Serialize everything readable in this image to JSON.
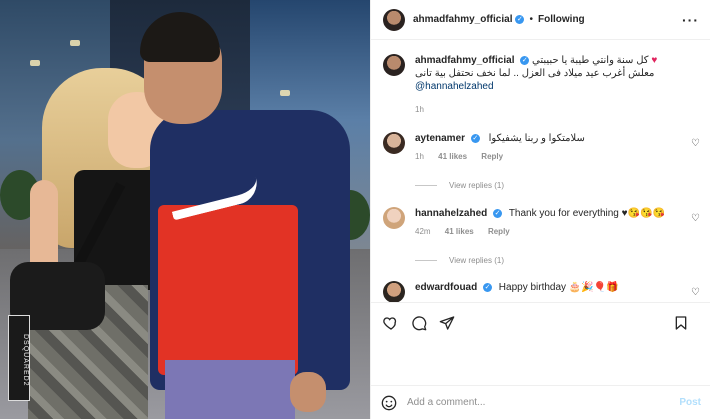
{
  "header": {
    "username": "ahmadfahmy_official",
    "separator": "•",
    "follow_status": "Following",
    "more_icon": "more-horizontal-icon"
  },
  "caption": {
    "username": "ahmadfahmy_official",
    "line1": "كل سنة وانتي طيبة يا حبيبتي",
    "line2": "معلش أغرب عيد ميلاد فى العزل .. لما نخف نحتفل بية تانى",
    "mention": "@hannahelzahed",
    "time": "1h"
  },
  "comments": [
    {
      "username": "aytenamer",
      "text": "سلامتكوا و ربنا يشفيكوا",
      "time": "1h",
      "likes": "41 likes",
      "reply": "Reply",
      "view_replies": "View replies (1)"
    },
    {
      "username": "hannahelzahed",
      "text": "Thank you for everything",
      "time": "42m",
      "likes": "41 likes",
      "reply": "Reply",
      "view_replies": "View replies (1)"
    },
    {
      "username": "edwardfouad",
      "text": "Happy birthday"
    }
  ],
  "add_comment": {
    "placeholder": "Add a comment...",
    "post_label": "Post"
  },
  "photo": {
    "tag_text": "DSQUARED2"
  },
  "colors": {
    "verified": "#3897f0",
    "mention": "#00376b",
    "post": "#b2dffc"
  }
}
